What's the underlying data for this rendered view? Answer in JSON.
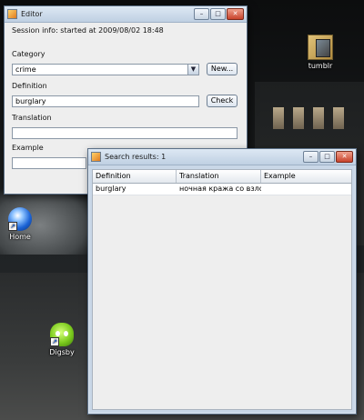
{
  "desktop": {
    "icons": [
      {
        "label": "tumblr",
        "icon": "folder-image-icon"
      },
      {
        "label": "Home",
        "icon": "home-globe-icon"
      },
      {
        "label": "Digsby",
        "icon": "digsby-icon"
      }
    ]
  },
  "editor": {
    "title": "Editor",
    "controls": {
      "minimize": "–",
      "maximize": "□",
      "close": "✕"
    },
    "session_info": "Session info: started at 2009/08/02 18:48",
    "category_label": "Category",
    "category_value": "crime",
    "new_button": "New...",
    "definition_label": "Definition",
    "definition_value": "burglary",
    "check_button": "Check",
    "translation_label": "Translation",
    "translation_value": "",
    "example_label": "Example",
    "example_value": ""
  },
  "results": {
    "title": "Search results: 1",
    "controls": {
      "minimize": "–",
      "maximize": "□",
      "close": "✕"
    },
    "columns": [
      "Definition",
      "Translation",
      "Example"
    ],
    "rows": [
      [
        "burglary",
        "ночная кража со взло...",
        ""
      ]
    ]
  }
}
